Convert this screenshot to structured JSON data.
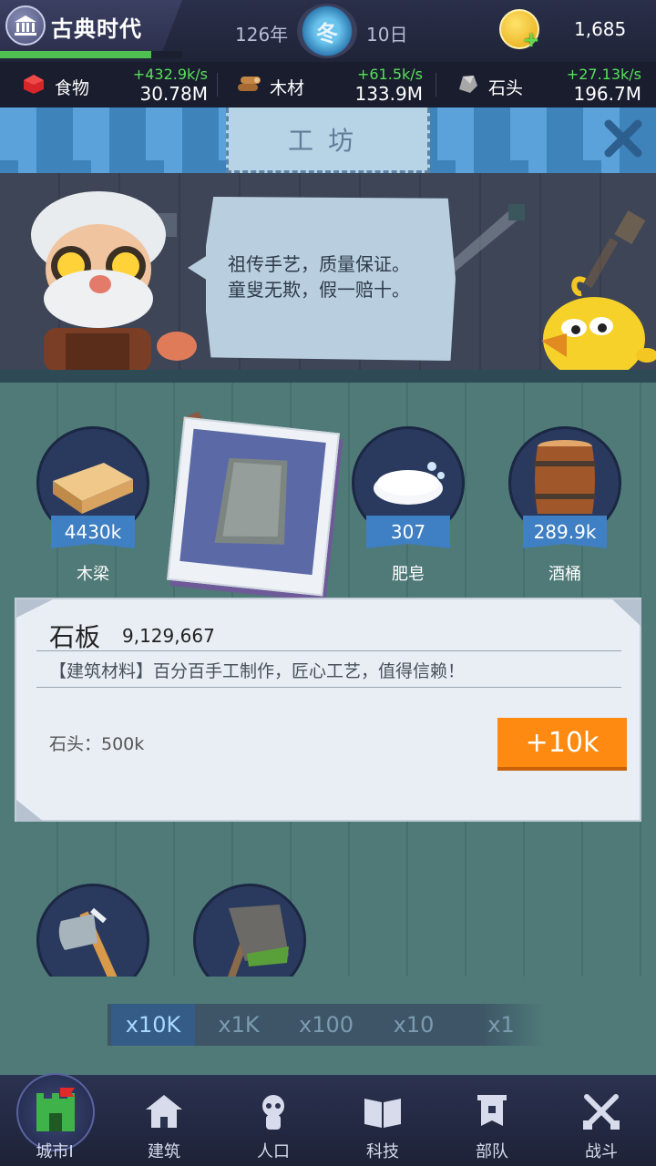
{
  "header": {
    "era_title": "古典时代",
    "era_progress_fraction": 0.83,
    "year": "126年",
    "season": "冬",
    "day": "10日",
    "coins": "1,685"
  },
  "resources": [
    {
      "name": "食物",
      "rate": "+432.9k/s",
      "total": "30.78M",
      "icon": "food-icon"
    },
    {
      "name": "木材",
      "rate": "+61.5k/s",
      "total": "133.9M",
      "icon": "wood-icon"
    },
    {
      "name": "石头",
      "rate": "+27.13k/s",
      "total": "196.7M",
      "icon": "stone-icon"
    }
  ],
  "workshop": {
    "title": "工坊",
    "dialog": [
      "祖传手艺，质量保证。",
      "童叟无欺，假一赔十。"
    ]
  },
  "items": [
    {
      "name": "木梁",
      "value": "4430k",
      "icon": "wood-beam-icon"
    },
    {
      "name": "石板",
      "value": "",
      "icon": "stone-slab-icon",
      "selected": true
    },
    {
      "name": "肥皂",
      "value": "307",
      "icon": "soap-icon"
    },
    {
      "name": "酒桶",
      "value": "289.9k",
      "icon": "barrel-icon"
    }
  ],
  "detail": {
    "title": "石板",
    "count": "9,129,667",
    "description": "【建筑材料】百分百手工制作，匠心工艺，值得信赖！",
    "cost": "石头：500k",
    "craft_label": "+10k"
  },
  "multipliers": [
    "x10K",
    "x1K",
    "x100",
    "x10",
    "x1"
  ],
  "active_multiplier": "x10K",
  "nav": [
    {
      "label": "城市I",
      "icon": "city-icon"
    },
    {
      "label": "建筑",
      "icon": "building-icon"
    },
    {
      "label": "人口",
      "icon": "population-icon"
    },
    {
      "label": "科技",
      "icon": "tech-book-icon"
    },
    {
      "label": "部队",
      "icon": "army-banner-icon"
    },
    {
      "label": "战斗",
      "icon": "battle-swords-icon"
    }
  ],
  "colors": {
    "accent_orange": "#ff8a12",
    "rate_green": "#58e05a",
    "ribbon_blue": "#3f7fc3",
    "wall_teal": "#4f7a78"
  }
}
